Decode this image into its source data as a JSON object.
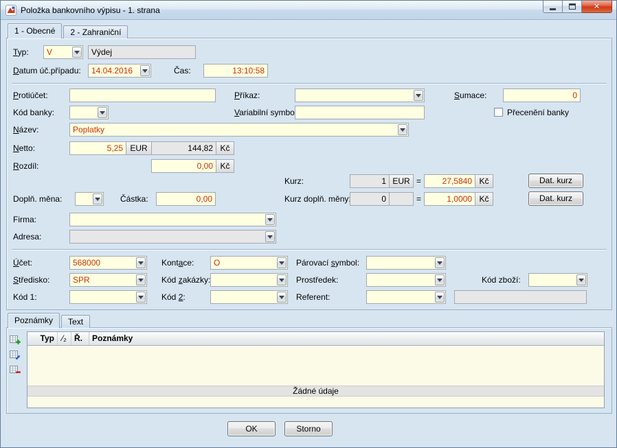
{
  "colors": {
    "accent_red": "#cc3300",
    "field_yellow": "#ffffe1",
    "dialog_bg": "#d7e5f1"
  },
  "window": {
    "title": "Položka bankovního výpisu - 1. strana"
  },
  "tabs": {
    "obecne": "1 - Obecné",
    "zahranicni": "2 - Zahraniční"
  },
  "fields": {
    "typ": {
      "label": "&Typ:",
      "value": "V",
      "text": "Výdej"
    },
    "datum": {
      "label": "&Datum úč.případu:",
      "value": "14.04.2016"
    },
    "cas": {
      "label": "Čas:",
      "value": "13:10:58"
    },
    "protiucet": {
      "label": "&Protiúčet:",
      "value": ""
    },
    "prikaz": {
      "label": "&Příkaz:",
      "value": ""
    },
    "sumace": {
      "label": "&Sumace:",
      "value": "0"
    },
    "kod_banky": {
      "label": "Kód banky:",
      "value": ""
    },
    "variabilni_symbol": {
      "label": "&Variabilní symbol:",
      "value": ""
    },
    "preceneni_banky": {
      "label": "Přecenění banky",
      "checked": false
    },
    "nazev": {
      "label": "&Název:",
      "value": "Poplatky"
    },
    "netto": {
      "label": "&Netto:",
      "amount": "5,25",
      "currency": "EUR",
      "amount_czk": "144,82",
      "currency_czk": "Kč"
    },
    "rozdil": {
      "label": "&Rozdíl:",
      "amount": "0,00",
      "currency": "Kč"
    },
    "kurz": {
      "label": "Kurz:",
      "qty": "1",
      "unit": "EUR",
      "equals": "=",
      "rate": "27,5840",
      "currency": "Kč",
      "button": "Dat. kurz"
    },
    "dopln_mena": {
      "label": "Doplň. měna:",
      "value": ""
    },
    "castka": {
      "label": "Částka:",
      "value": "0,00"
    },
    "kurz_dopln": {
      "label": "Kurz doplň. měny:",
      "qty": "0",
      "unit": "",
      "equals": "=",
      "rate": "1,0000",
      "currency": "Kč",
      "button": "Dat. kurz"
    },
    "firma": {
      "label": "Firma:",
      "value": ""
    },
    "adresa": {
      "label": "Adresa:",
      "value": ""
    },
    "ucet": {
      "label": "&Účet:",
      "value": "568000"
    },
    "kontace": {
      "label": "Kont&ace:",
      "value": "O"
    },
    "parovaci_symbol": {
      "label": "Párovací &symbol:",
      "value": ""
    },
    "stredisko": {
      "label": "&Středisko:",
      "value": "SPR"
    },
    "kod_zakazky": {
      "label": "Kód &zakázky:",
      "value": ""
    },
    "prostredek": {
      "label": "Prostředek:",
      "value": ""
    },
    "kod_zbozi": {
      "label": "Kód zboží:",
      "value": ""
    },
    "kod1": {
      "label": "Kód 1:",
      "value": ""
    },
    "kod2": {
      "label": "Kód &2:",
      "value": ""
    },
    "referent": {
      "label": "Referent:",
      "value": ""
    }
  },
  "notes": {
    "tabs": {
      "poznamky": "Poznámky",
      "text": "Text"
    },
    "columns": {
      "typ": "Typ",
      "sort": "⁄₂",
      "radek": "Ř.",
      "poznamky": "Poznámky"
    },
    "empty_text": "Žádné údaje"
  },
  "buttons": {
    "ok": "OK",
    "storno": "Storno"
  }
}
